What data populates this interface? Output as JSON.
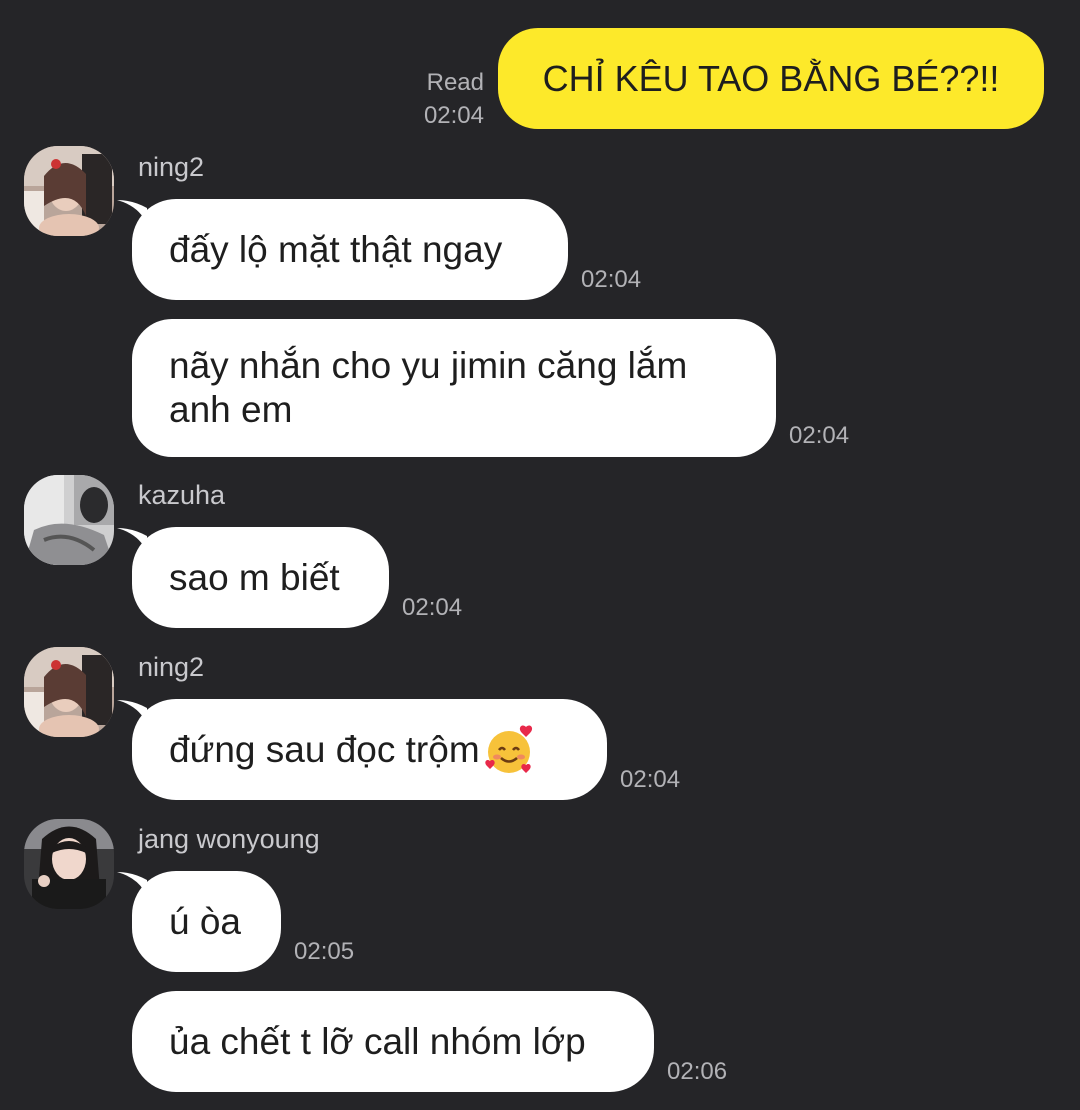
{
  "outgoing": {
    "read_label": "Read",
    "time": "02:04",
    "text": "CHỈ KÊU TAO BẰNG BÉ??!!",
    "bubble_color": "#fde92a"
  },
  "messages": [
    {
      "sender": "ning2",
      "avatar": "ning2-avatar",
      "text": "đấy lộ mặt thật ngay",
      "time": "02:04"
    },
    {
      "sender": "",
      "avatar": "",
      "text": "nãy nhắn cho yu jimin căng lắm anh em",
      "time": "02:04"
    },
    {
      "sender": "kazuha",
      "avatar": "kazuha-avatar",
      "text": "sao m biết",
      "time": "02:04"
    },
    {
      "sender": "ning2",
      "avatar": "ning2-avatar",
      "text": "đứng sau đọc trộm",
      "emoji": "smiling-face-with-hearts",
      "time": "02:04"
    },
    {
      "sender": "jang wonyoung",
      "avatar": "wonyoung-avatar",
      "text": "ú òa",
      "time": "02:05"
    },
    {
      "sender": "",
      "avatar": "",
      "text": "ủa chết t lỡ call nhóm lớp",
      "time": "02:06"
    }
  ],
  "colors": {
    "background": "#252528",
    "incoming_bubble": "#ffffff",
    "meta_text": "#b2b2b6"
  }
}
